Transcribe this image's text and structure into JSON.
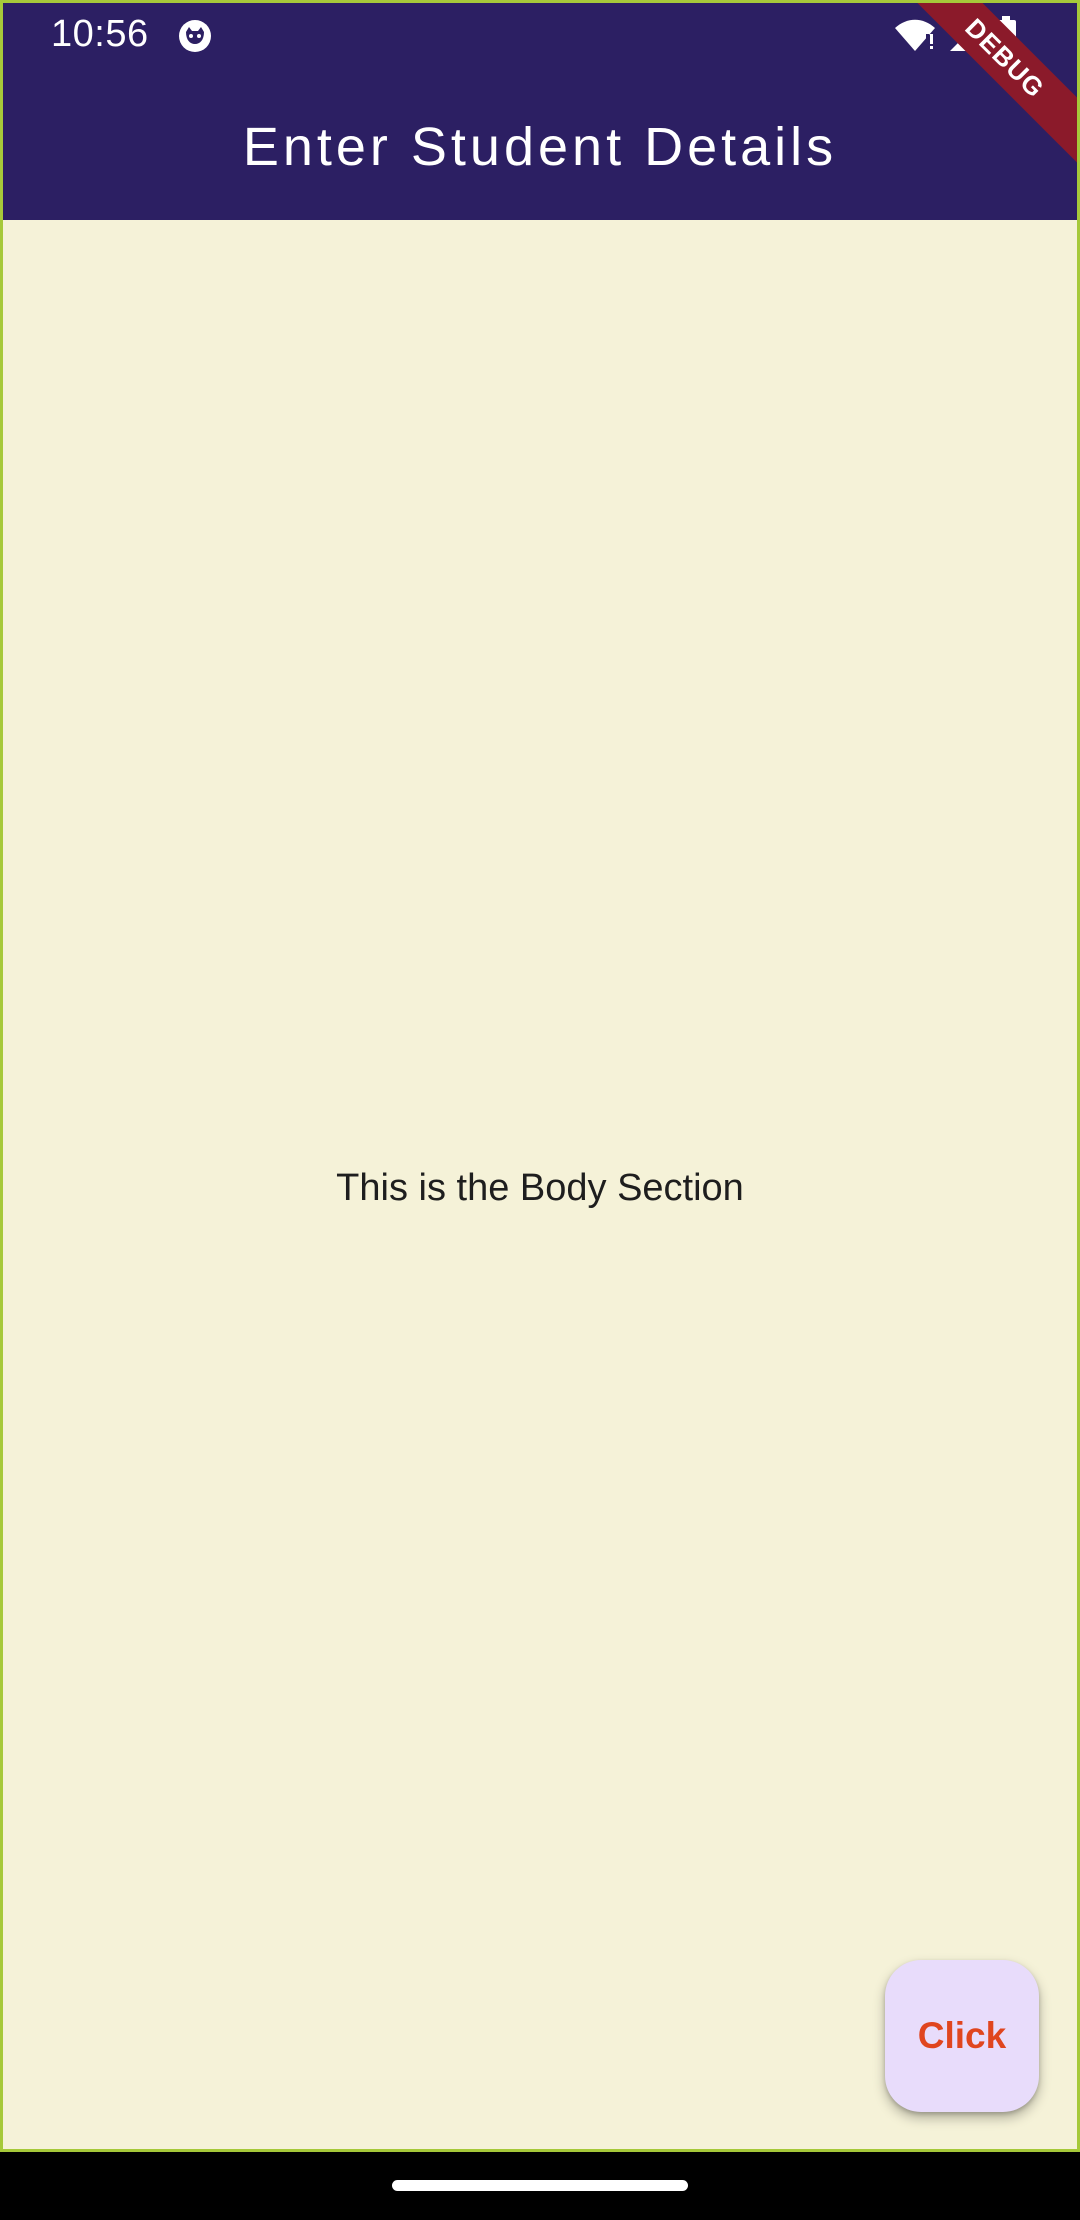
{
  "status_bar": {
    "time": "10:56",
    "icons": [
      "app-notification-icon",
      "wifi-icon",
      "cell-signal-icon",
      "battery-icon"
    ]
  },
  "app_bar": {
    "title": "Enter Student Details",
    "background_color": "#2c1f63"
  },
  "debug_banner": {
    "label": "DEBUG"
  },
  "body": {
    "text": "This is the Body Section",
    "background_color": "#f5f2d8"
  },
  "fab": {
    "label": "Click",
    "background_color": "#e8dcfb",
    "text_color": "#e0451f"
  }
}
